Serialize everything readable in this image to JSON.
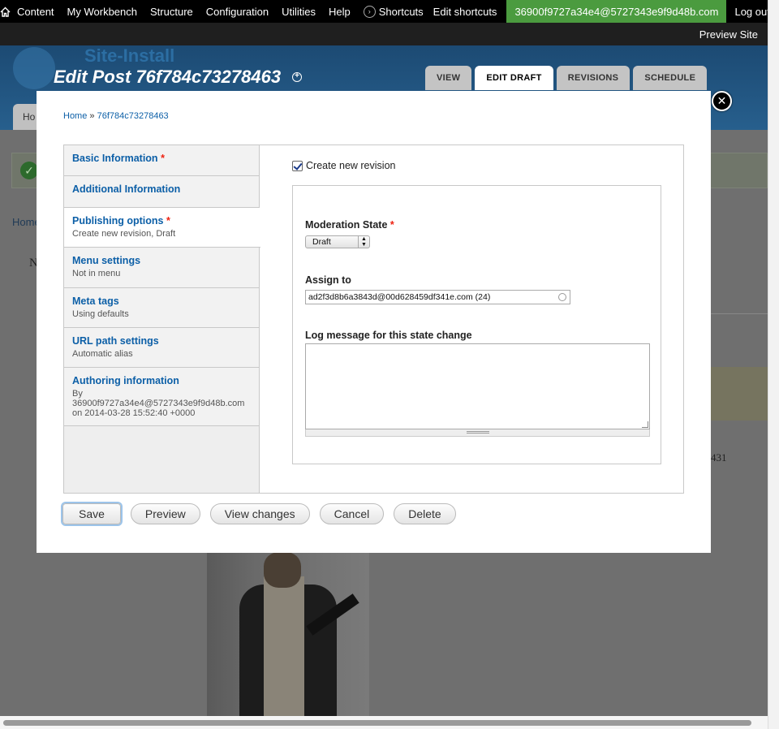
{
  "toolbar": {
    "menu": [
      "Content",
      "My Workbench",
      "Structure",
      "Configuration",
      "Utilities",
      "Help"
    ],
    "shortcuts": "Shortcuts",
    "edit_shortcuts": "Edit shortcuts",
    "user": "36900f9727a34e4@5727343e9f9d48b.com",
    "logout": "Log out",
    "preview_site": "Preview Site"
  },
  "header": {
    "site_name": "Site-Install",
    "page_title": "Edit Post 76f784c73278463",
    "tabs": [
      "VIEW",
      "EDIT DRAFT",
      "REVISIONS",
      "SCHEDULE"
    ],
    "active_tab": "EDIT DRAFT",
    "secondary_tab": "Ho"
  },
  "background": {
    "breadcrumb_fragment": "Home",
    "side_letter": "N",
    "side_number": "431"
  },
  "modal": {
    "breadcrumb": {
      "home": "Home",
      "separator": "»",
      "current": "76f784c73278463"
    },
    "vertical_tabs": [
      {
        "title": "Basic Information",
        "required": "*",
        "summary": ""
      },
      {
        "title": "Additional Information",
        "required": "",
        "summary": ""
      },
      {
        "title": "Publishing options",
        "required": "*",
        "summary": "Create new revision, Draft"
      },
      {
        "title": "Menu settings",
        "required": "",
        "summary": "Not in menu"
      },
      {
        "title": "Meta tags",
        "required": "",
        "summary": "Using defaults"
      },
      {
        "title": "URL path settings",
        "required": "",
        "summary": "Automatic alias"
      },
      {
        "title": "Authoring information",
        "required": "",
        "summary": "By 36900f9727a34e4@5727343e9f9d48b.com on 2014-03-28 15:52:40 +0000"
      }
    ],
    "pane": {
      "create_revision_label": "Create new revision",
      "create_revision_checked": true,
      "moderation_label": "Moderation State",
      "moderation_required": "*",
      "moderation_value": "Draft",
      "assign_label": "Assign to",
      "assign_value": "ad2f3d8b6a3843d@00d628459df341e.com (24)",
      "log_label": "Log message for this state change",
      "log_value": ""
    },
    "buttons": [
      "Save",
      "Preview",
      "View changes",
      "Cancel",
      "Delete"
    ],
    "close_icon": "close-icon"
  }
}
